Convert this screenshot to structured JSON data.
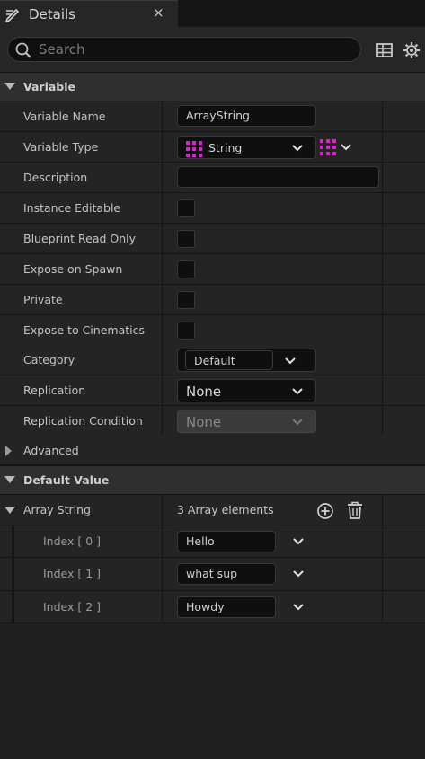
{
  "tab": {
    "title": "Details",
    "icon": "pencil-icon",
    "close_glyph": "×"
  },
  "search": {
    "placeholder": "Search",
    "value": ""
  },
  "toolbar": {
    "icons": [
      "table-icon",
      "settings-gear-icon"
    ]
  },
  "sections": {
    "variable": "Variable",
    "advanced": "Advanced",
    "default_value": "Default Value"
  },
  "variable": {
    "name_label": "Variable Name",
    "name_value": "ArrayString",
    "type_label": "Variable Type",
    "type_value": "String",
    "description_label": "Description",
    "description_value": "",
    "instance_editable_label": "Instance Editable",
    "blueprint_read_only_label": "Blueprint Read Only",
    "expose_on_spawn_label": "Expose on Spawn",
    "private_label": "Private",
    "expose_to_cinematics_label": "Expose to Cinematics",
    "category_label": "Category",
    "category_value": "Default",
    "replication_label": "Replication",
    "replication_value": "None",
    "replication_condition_label": "Replication Condition",
    "replication_condition_value": "None"
  },
  "default_value": {
    "array_label": "Array String",
    "array_count": "3 Array elements",
    "elements": [
      {
        "label": "Index [ 0 ]",
        "value": "Hello"
      },
      {
        "label": "Index [ 1 ]",
        "value": "what sup"
      },
      {
        "label": "Index [ 2 ]",
        "value": "Howdy"
      }
    ]
  },
  "colors": {
    "string_type_accent": "#e020d0",
    "panel_bg": "#242424",
    "section_bg": "#2f2f2f"
  }
}
